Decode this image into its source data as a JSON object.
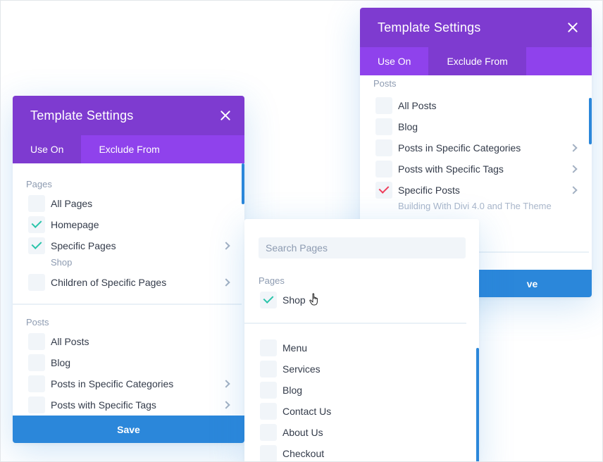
{
  "back_panel": {
    "title": "Template Settings",
    "tabs": [
      "Use On",
      "Exclude From"
    ],
    "section": "Posts",
    "items": [
      {
        "label": "All Posts"
      },
      {
        "label": "Blog"
      },
      {
        "label": "Posts in Specific Categories"
      },
      {
        "label": "Posts with Specific Tags"
      },
      {
        "label": "Specific Posts"
      }
    ],
    "specific_posts_value": "Building With Divi 4.0 and The Theme",
    "save_partial": "ve"
  },
  "front_panel": {
    "title": "Template Settings",
    "tabs": [
      "Use On",
      "Exclude From"
    ],
    "pages_section": "Pages",
    "pages": [
      {
        "label": "All Pages"
      },
      {
        "label": "Homepage"
      },
      {
        "label": "Specific Pages"
      },
      {
        "label": "Children of Specific Pages"
      }
    ],
    "specific_pages_value": "Shop",
    "posts_section": "Posts",
    "posts": [
      {
        "label": "All Posts"
      },
      {
        "label": "Blog"
      },
      {
        "label": "Posts in Specific Categories"
      },
      {
        "label": "Posts with Specific Tags"
      }
    ],
    "save_label": "Save"
  },
  "dropdown": {
    "search_placeholder": "Search Pages",
    "section": "Pages",
    "selected": "Shop",
    "items": [
      "Menu",
      "Services",
      "Blog",
      "Contact Us",
      "About Us",
      "Checkout"
    ]
  },
  "colors": {
    "header_purple": "#7e3bd0",
    "tab_purple": "#8f42ec",
    "save_blue": "#2b87da",
    "check_green": "#29c4a9",
    "check_red": "#ef3e5b"
  }
}
